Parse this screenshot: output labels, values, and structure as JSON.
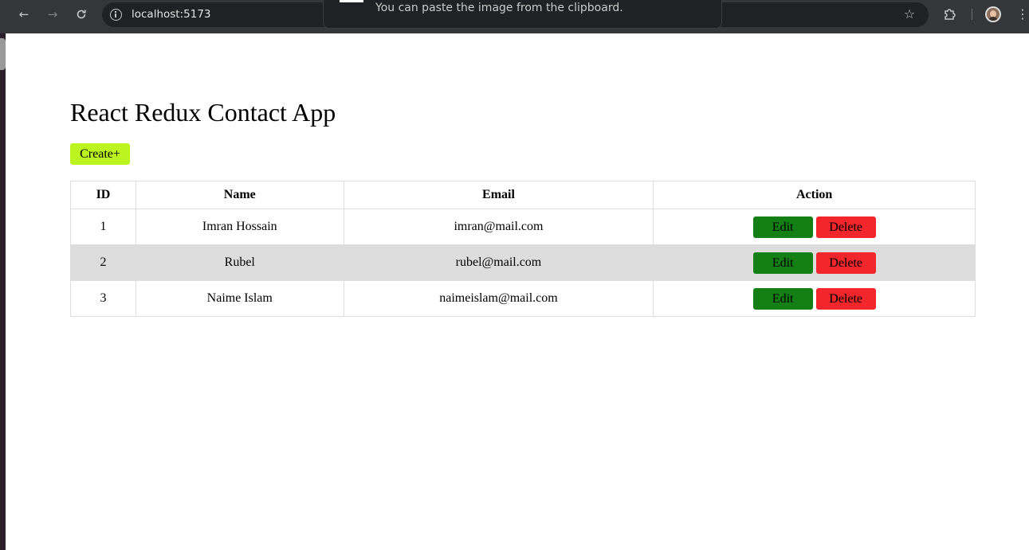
{
  "browser": {
    "url": "localhost:5173",
    "notification": "You can paste the image from the clipboard.",
    "icons": {
      "back": "arrow-left-icon",
      "forward": "arrow-right-icon",
      "reload": "reload-icon",
      "info": "info-icon",
      "bookmark": "star-icon",
      "extensions": "puzzle-icon",
      "profile": "avatar",
      "menu": "kebab-menu-icon"
    }
  },
  "app": {
    "title": "React Redux Contact App",
    "create_label": "Create+",
    "colors": {
      "create_button": "#bbf41e",
      "edit_button": "#137f14",
      "delete_button": "#f2262b",
      "row_stripe": "#dddddd"
    }
  },
  "table": {
    "headers": [
      "ID",
      "Name",
      "Email",
      "Action"
    ],
    "rows": [
      {
        "id": "1",
        "name": "Imran Hossain",
        "email": "imran@mail.com",
        "edit_label": "Edit",
        "delete_label": "Delete"
      },
      {
        "id": "2",
        "name": "Rubel",
        "email": "rubel@mail.com",
        "edit_label": "Edit",
        "delete_label": "Delete"
      },
      {
        "id": "3",
        "name": "Naime Islam",
        "email": "naimeislam@mail.com",
        "edit_label": "Edit",
        "delete_label": "Delete"
      }
    ]
  }
}
